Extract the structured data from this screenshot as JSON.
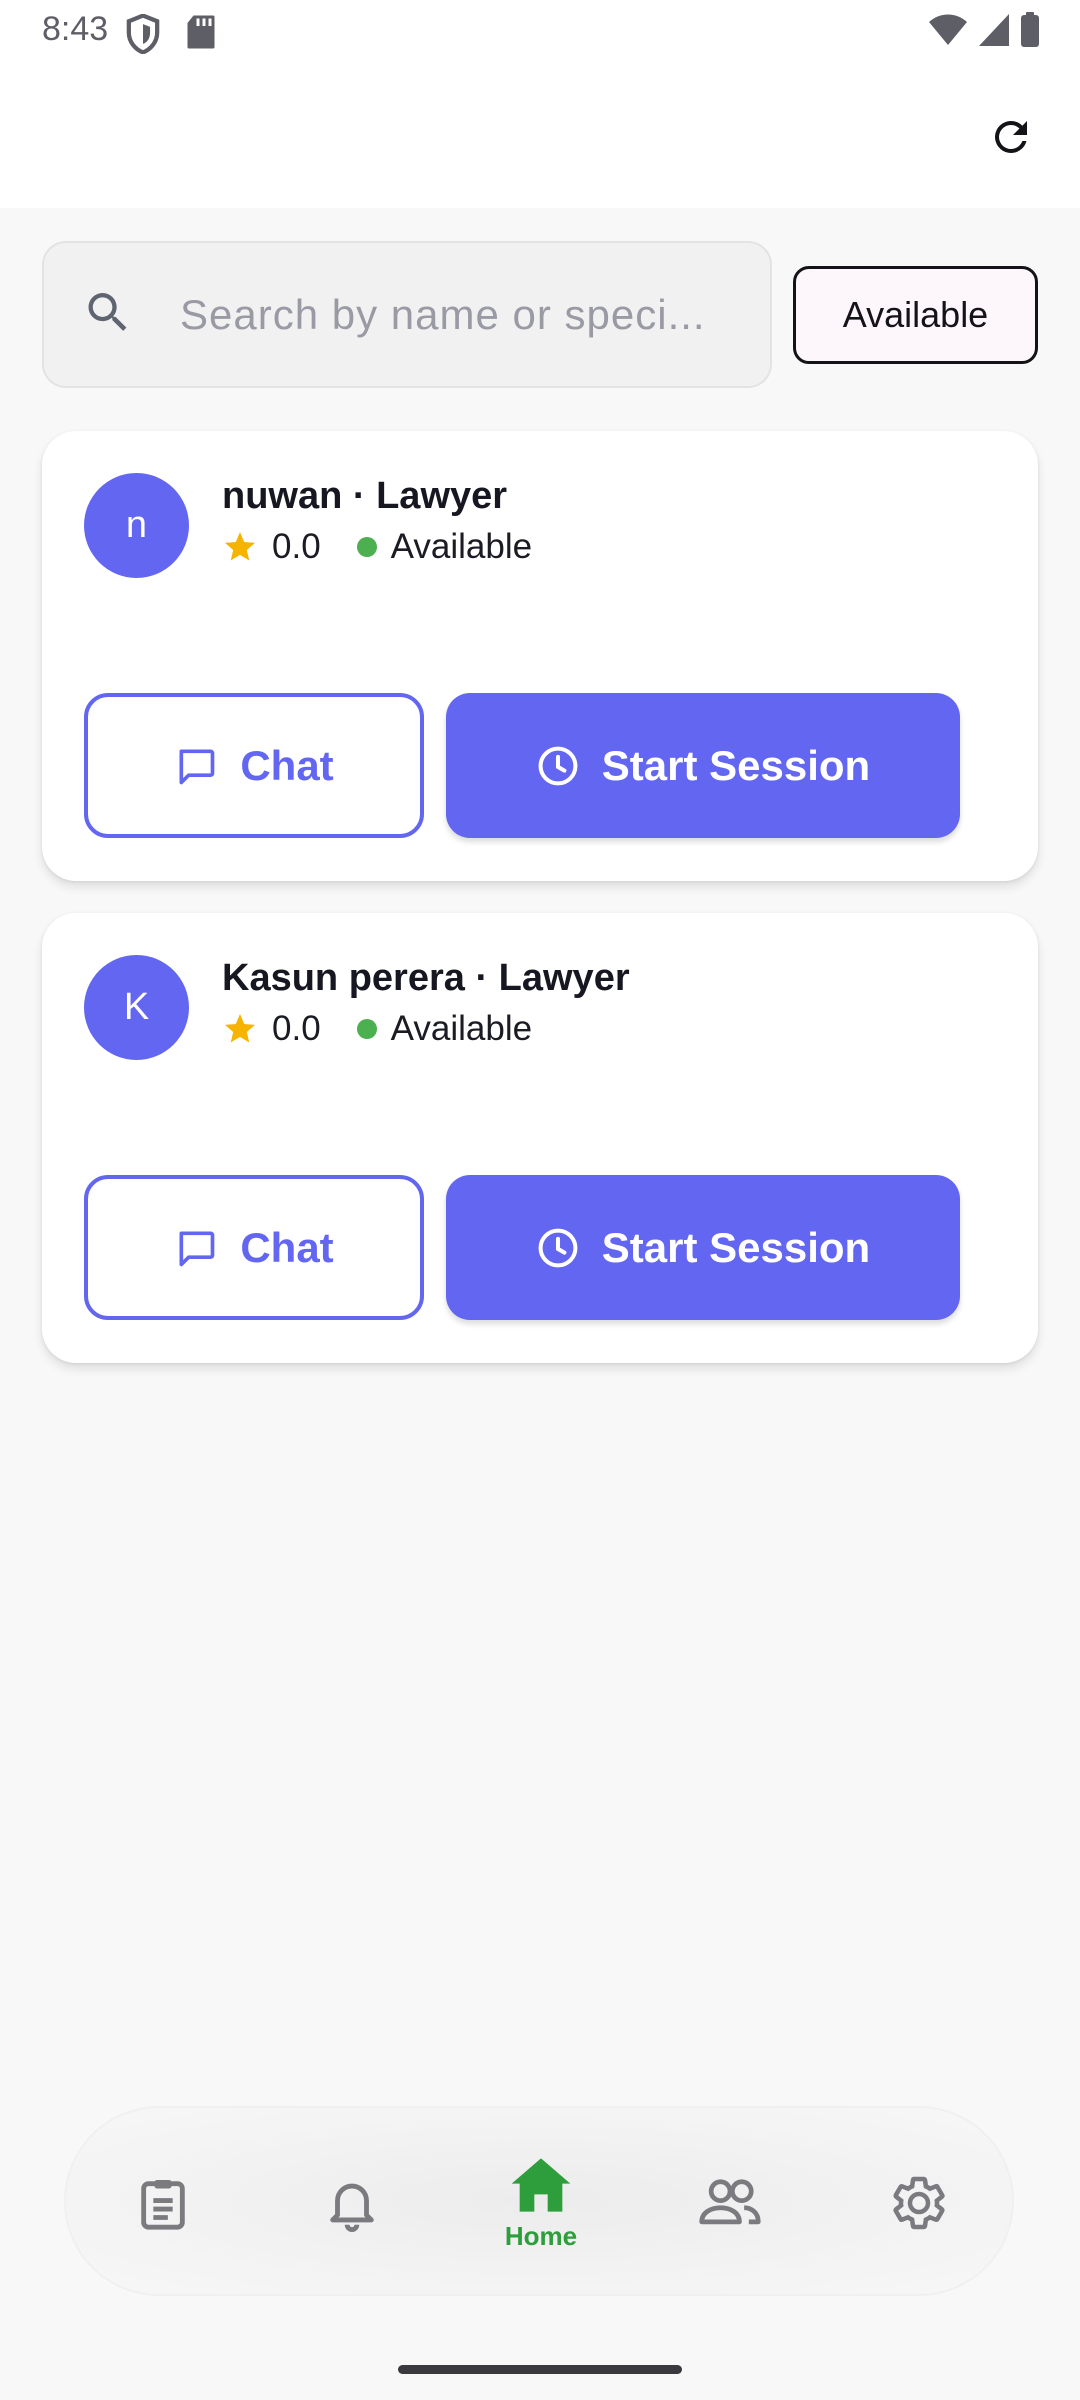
{
  "status_bar": {
    "time": "8:43"
  },
  "search": {
    "placeholder": "Search by name or speci..."
  },
  "filter": {
    "label": "Available"
  },
  "lawyers": [
    {
      "initial": "n",
      "title": "nuwan · Lawyer",
      "rating": "0.0",
      "status": "Available",
      "chat_label": "Chat",
      "start_label": "Start Session"
    },
    {
      "initial": "K",
      "title": "Kasun perera · Lawyer",
      "rating": "0.0",
      "status": "Available",
      "chat_label": "Chat",
      "start_label": "Start Session"
    }
  ],
  "bottom_nav": {
    "items": [
      {
        "icon": "clipboard-icon",
        "label": ""
      },
      {
        "icon": "bell-icon",
        "label": ""
      },
      {
        "icon": "home-icon",
        "label": "Home",
        "active": true
      },
      {
        "icon": "people-icon",
        "label": ""
      },
      {
        "icon": "gear-icon",
        "label": ""
      }
    ]
  },
  "colors": {
    "primary": "#6366f1",
    "available": "#4caf50",
    "star": "#f6b400",
    "nav_active": "#2e9e3c",
    "nav_inactive": "#7a7a7f"
  }
}
